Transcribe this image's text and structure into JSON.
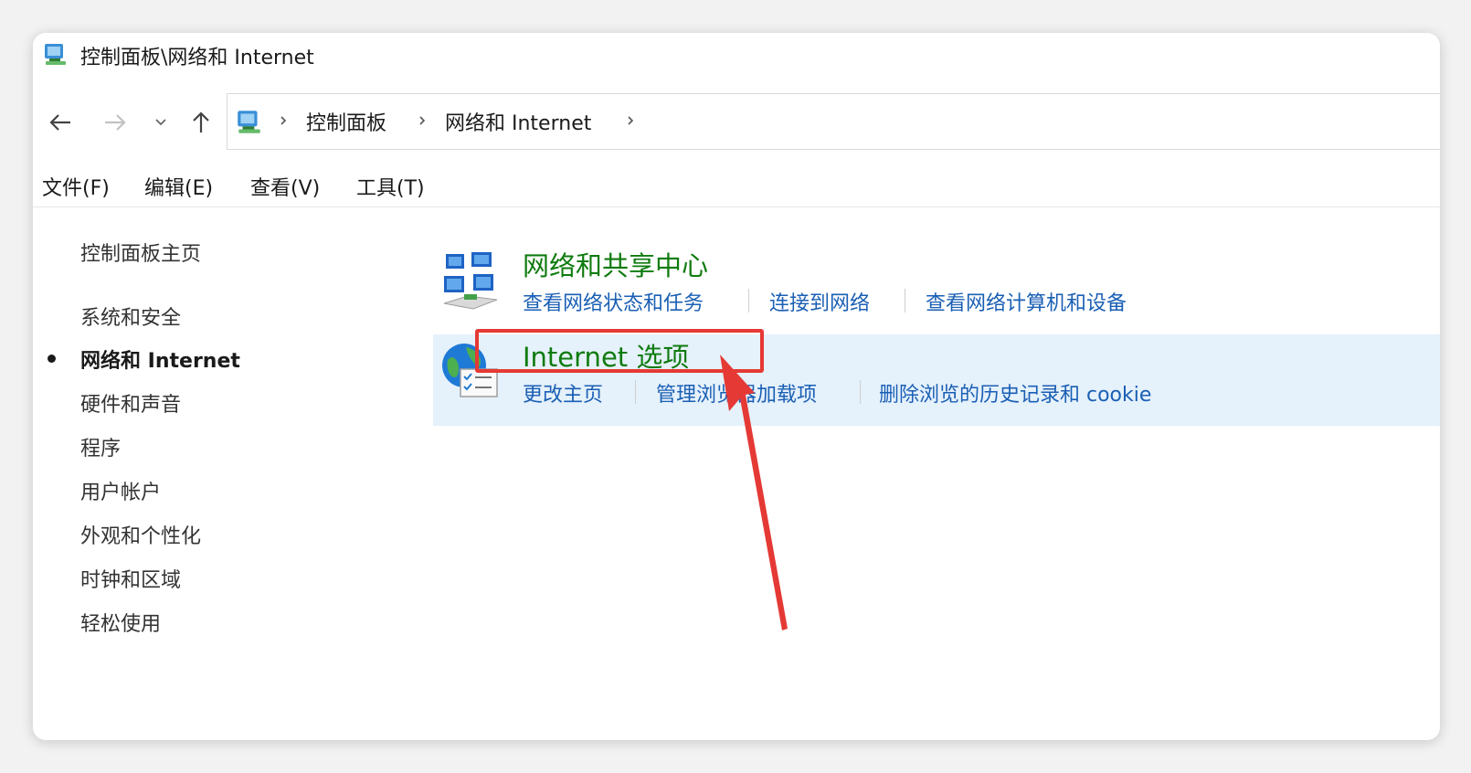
{
  "titlebar": {
    "title": "控制面板\\网络和 Internet"
  },
  "address": {
    "crumbs": [
      "控制面板",
      "网络和 Internet"
    ]
  },
  "menu": {
    "file": "文件(F)",
    "edit": "编辑(E)",
    "view": "查看(V)",
    "tools": "工具(T)"
  },
  "sidebar": {
    "home": "控制面板主页",
    "items": [
      "系统和安全",
      "网络和 Internet",
      "硬件和声音",
      "程序",
      "用户帐户",
      "外观和个性化",
      "时钟和区域",
      "轻松使用"
    ],
    "active_index": 1
  },
  "categories": {
    "network_center": {
      "title": "网络和共享中心",
      "links": [
        "查看网络状态和任务",
        "连接到网络",
        "查看网络计算机和设备"
      ]
    },
    "internet_options": {
      "title": "Internet 选项",
      "links": [
        "更改主页",
        "管理浏览器加载项",
        "删除浏览的历史记录和 cookie"
      ]
    }
  },
  "colors": {
    "title_green": "#0f7b0f",
    "link_blue": "#1a5fb4",
    "highlight": "#e5f1fb",
    "annotation_red": "#e53935"
  },
  "icons": {
    "window": "network-folder-icon",
    "network_center": "network-computers-icon",
    "internet_options": "globe-checklist-icon"
  }
}
